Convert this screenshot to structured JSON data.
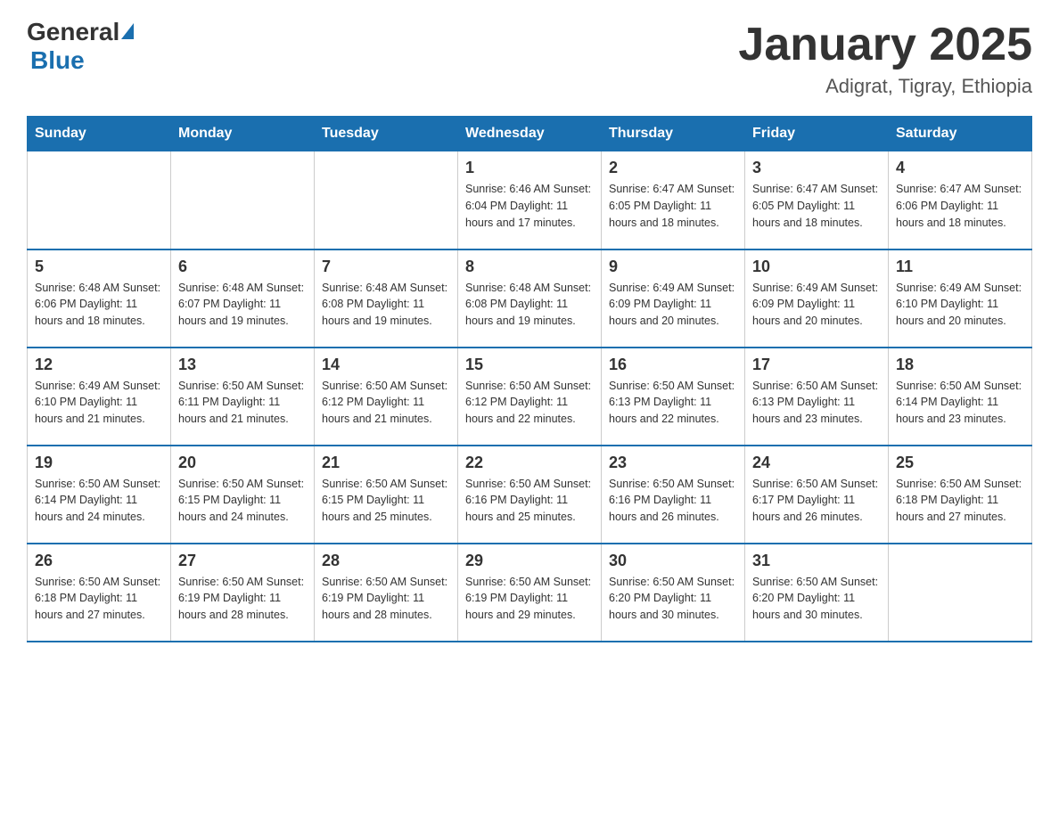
{
  "header": {
    "logo_general": "General",
    "logo_blue": "Blue",
    "month_title": "January 2025",
    "location": "Adigrat, Tigray, Ethiopia"
  },
  "days_of_week": [
    "Sunday",
    "Monday",
    "Tuesday",
    "Wednesday",
    "Thursday",
    "Friday",
    "Saturday"
  ],
  "weeks": [
    [
      {
        "day": "",
        "info": ""
      },
      {
        "day": "",
        "info": ""
      },
      {
        "day": "",
        "info": ""
      },
      {
        "day": "1",
        "info": "Sunrise: 6:46 AM\nSunset: 6:04 PM\nDaylight: 11 hours\nand 17 minutes."
      },
      {
        "day": "2",
        "info": "Sunrise: 6:47 AM\nSunset: 6:05 PM\nDaylight: 11 hours\nand 18 minutes."
      },
      {
        "day": "3",
        "info": "Sunrise: 6:47 AM\nSunset: 6:05 PM\nDaylight: 11 hours\nand 18 minutes."
      },
      {
        "day": "4",
        "info": "Sunrise: 6:47 AM\nSunset: 6:06 PM\nDaylight: 11 hours\nand 18 minutes."
      }
    ],
    [
      {
        "day": "5",
        "info": "Sunrise: 6:48 AM\nSunset: 6:06 PM\nDaylight: 11 hours\nand 18 minutes."
      },
      {
        "day": "6",
        "info": "Sunrise: 6:48 AM\nSunset: 6:07 PM\nDaylight: 11 hours\nand 19 minutes."
      },
      {
        "day": "7",
        "info": "Sunrise: 6:48 AM\nSunset: 6:08 PM\nDaylight: 11 hours\nand 19 minutes."
      },
      {
        "day": "8",
        "info": "Sunrise: 6:48 AM\nSunset: 6:08 PM\nDaylight: 11 hours\nand 19 minutes."
      },
      {
        "day": "9",
        "info": "Sunrise: 6:49 AM\nSunset: 6:09 PM\nDaylight: 11 hours\nand 20 minutes."
      },
      {
        "day": "10",
        "info": "Sunrise: 6:49 AM\nSunset: 6:09 PM\nDaylight: 11 hours\nand 20 minutes."
      },
      {
        "day": "11",
        "info": "Sunrise: 6:49 AM\nSunset: 6:10 PM\nDaylight: 11 hours\nand 20 minutes."
      }
    ],
    [
      {
        "day": "12",
        "info": "Sunrise: 6:49 AM\nSunset: 6:10 PM\nDaylight: 11 hours\nand 21 minutes."
      },
      {
        "day": "13",
        "info": "Sunrise: 6:50 AM\nSunset: 6:11 PM\nDaylight: 11 hours\nand 21 minutes."
      },
      {
        "day": "14",
        "info": "Sunrise: 6:50 AM\nSunset: 6:12 PM\nDaylight: 11 hours\nand 21 minutes."
      },
      {
        "day": "15",
        "info": "Sunrise: 6:50 AM\nSunset: 6:12 PM\nDaylight: 11 hours\nand 22 minutes."
      },
      {
        "day": "16",
        "info": "Sunrise: 6:50 AM\nSunset: 6:13 PM\nDaylight: 11 hours\nand 22 minutes."
      },
      {
        "day": "17",
        "info": "Sunrise: 6:50 AM\nSunset: 6:13 PM\nDaylight: 11 hours\nand 23 minutes."
      },
      {
        "day": "18",
        "info": "Sunrise: 6:50 AM\nSunset: 6:14 PM\nDaylight: 11 hours\nand 23 minutes."
      }
    ],
    [
      {
        "day": "19",
        "info": "Sunrise: 6:50 AM\nSunset: 6:14 PM\nDaylight: 11 hours\nand 24 minutes."
      },
      {
        "day": "20",
        "info": "Sunrise: 6:50 AM\nSunset: 6:15 PM\nDaylight: 11 hours\nand 24 minutes."
      },
      {
        "day": "21",
        "info": "Sunrise: 6:50 AM\nSunset: 6:15 PM\nDaylight: 11 hours\nand 25 minutes."
      },
      {
        "day": "22",
        "info": "Sunrise: 6:50 AM\nSunset: 6:16 PM\nDaylight: 11 hours\nand 25 minutes."
      },
      {
        "day": "23",
        "info": "Sunrise: 6:50 AM\nSunset: 6:16 PM\nDaylight: 11 hours\nand 26 minutes."
      },
      {
        "day": "24",
        "info": "Sunrise: 6:50 AM\nSunset: 6:17 PM\nDaylight: 11 hours\nand 26 minutes."
      },
      {
        "day": "25",
        "info": "Sunrise: 6:50 AM\nSunset: 6:18 PM\nDaylight: 11 hours\nand 27 minutes."
      }
    ],
    [
      {
        "day": "26",
        "info": "Sunrise: 6:50 AM\nSunset: 6:18 PM\nDaylight: 11 hours\nand 27 minutes."
      },
      {
        "day": "27",
        "info": "Sunrise: 6:50 AM\nSunset: 6:19 PM\nDaylight: 11 hours\nand 28 minutes."
      },
      {
        "day": "28",
        "info": "Sunrise: 6:50 AM\nSunset: 6:19 PM\nDaylight: 11 hours\nand 28 minutes."
      },
      {
        "day": "29",
        "info": "Sunrise: 6:50 AM\nSunset: 6:19 PM\nDaylight: 11 hours\nand 29 minutes."
      },
      {
        "day": "30",
        "info": "Sunrise: 6:50 AM\nSunset: 6:20 PM\nDaylight: 11 hours\nand 30 minutes."
      },
      {
        "day": "31",
        "info": "Sunrise: 6:50 AM\nSunset: 6:20 PM\nDaylight: 11 hours\nand 30 minutes."
      },
      {
        "day": "",
        "info": ""
      }
    ]
  ],
  "colors": {
    "header_bg": "#1a6faf",
    "header_text": "#ffffff",
    "border": "#cccccc",
    "text": "#333333"
  }
}
